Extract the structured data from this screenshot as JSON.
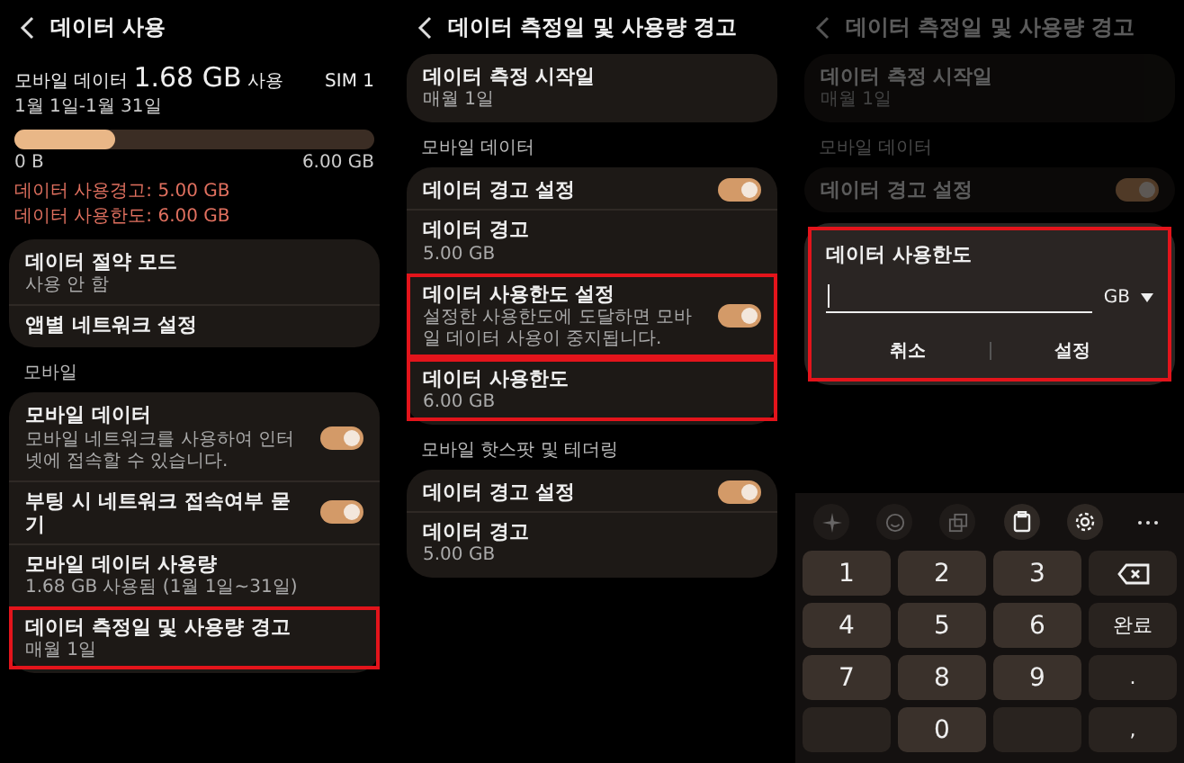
{
  "panels": [
    {
      "title": "데이터 사용",
      "dimmed": false,
      "blocks": [
        {
          "kind": "usage",
          "label": "모바일 데이터",
          "amount": "1.68 GB",
          "unit": "사용",
          "sim": "SIM 1",
          "period": "1월 1일-1월 31일",
          "level": 0.28,
          "min": "0 B",
          "max": "6.00 GB",
          "notes": [
            "데이터 사용경고: 5.00 GB",
            "데이터 사용한도: 6.00 GB"
          ]
        },
        {
          "kind": "card",
          "items": [
            {
              "kind": "nav",
              "title": "데이터 절약 모드",
              "subtitle": "사용 안 함",
              "highlighted": false
            },
            {
              "kind": "nav",
              "title": "앱별 네트워크 설정",
              "highlighted": false
            }
          ]
        },
        {
          "kind": "section",
          "label": "모바일"
        },
        {
          "kind": "card",
          "items": [
            {
              "kind": "toggle",
              "title": "모바일 데이터",
              "subtitle": "모바일 네트워크를 사용하여 인터넷에 접속할 수 있습니다.",
              "on": true,
              "highlighted": false
            },
            {
              "kind": "toggle",
              "title": "부팅 시 네트워크 접속여부 묻기",
              "on": true,
              "highlighted": false
            },
            {
              "kind": "nav",
              "title": "모바일 데이터 사용량",
              "subtitle": "1.68 GB 사용됨 (1월 1일~31일)",
              "highlighted": false
            },
            {
              "kind": "nav",
              "title": "데이터 측정일 및 사용량 경고",
              "subtitle": "매월 1일",
              "highlighted": true
            }
          ]
        }
      ]
    },
    {
      "title": "데이터 측정일 및 사용량 경고",
      "dimmed": false,
      "blocks": [
        {
          "kind": "card",
          "items": [
            {
              "kind": "nav",
              "title": "데이터 측정 시작일",
              "subtitle": "매월 1일",
              "highlighted": false
            }
          ]
        },
        {
          "kind": "section",
          "label": "모바일 데이터"
        },
        {
          "kind": "card",
          "items": [
            {
              "kind": "toggle",
              "title": "데이터 경고 설정",
              "on": true,
              "highlighted": false
            },
            {
              "kind": "nav",
              "title": "데이터 경고",
              "subtitle": "5.00 GB",
              "highlighted": false
            },
            {
              "kind": "toggle",
              "title": "데이터 사용한도 설정",
              "subtitle": "설정한 사용한도에 도달하면 모바일 데이터 사용이 중지됩니다.",
              "on": true,
              "highlighted": true
            },
            {
              "kind": "nav",
              "title": "데이터 사용한도",
              "subtitle": "6.00 GB",
              "highlighted": true
            }
          ]
        },
        {
          "kind": "section",
          "label": "모바일 핫스팟 및 테더링"
        },
        {
          "kind": "card",
          "items": [
            {
              "kind": "toggle",
              "title": "데이터 경고 설정",
              "on": true,
              "highlighted": false
            },
            {
              "kind": "nav",
              "title": "데이터 경고",
              "subtitle": "5.00 GB",
              "highlighted": false
            }
          ]
        }
      ]
    },
    {
      "title": "데이터 측정일 및 사용량 경고",
      "dimmed": true,
      "blocks": [
        {
          "kind": "card",
          "items": [
            {
              "kind": "nav",
              "title": "데이터 측정 시작일",
              "subtitle": "매월 1일",
              "highlighted": false
            }
          ]
        },
        {
          "kind": "section",
          "label": "모바일 데이터"
        },
        {
          "kind": "card",
          "items": [
            {
              "kind": "toggle",
              "title": "데이터 경고 설정",
              "on": true,
              "highlighted": false
            }
          ]
        },
        {
          "kind": "dialog",
          "title": "데이터 사용한도",
          "unit": "GB",
          "buttons": [
            "취소",
            "설정"
          ],
          "highlighted": true
        },
        {
          "kind": "keyboard",
          "tools": [
            {
              "kind": "sparkle",
              "enabled": false
            },
            {
              "kind": "emoji",
              "enabled": false
            },
            {
              "kind": "copy",
              "enabled": false
            },
            {
              "kind": "clipboard",
              "enabled": true
            },
            {
              "kind": "settings",
              "enabled": true
            },
            {
              "kind": "more",
              "enabled": true
            }
          ],
          "keys": [
            {
              "kind": "digit",
              "label": "1"
            },
            {
              "kind": "digit",
              "label": "2"
            },
            {
              "kind": "digit",
              "label": "3"
            },
            {
              "kind": "backspace"
            },
            {
              "kind": "digit",
              "label": "4"
            },
            {
              "kind": "digit",
              "label": "5"
            },
            {
              "kind": "digit",
              "label": "6"
            },
            {
              "kind": "action",
              "label": "완료"
            },
            {
              "kind": "digit",
              "label": "7"
            },
            {
              "kind": "digit",
              "label": "8"
            },
            {
              "kind": "digit",
              "label": "9"
            },
            {
              "kind": "action",
              "label": "."
            },
            {
              "kind": "blank"
            },
            {
              "kind": "digit",
              "label": "0"
            },
            {
              "kind": "blank"
            },
            {
              "kind": "action",
              "label": ","
            }
          ]
        }
      ]
    }
  ]
}
